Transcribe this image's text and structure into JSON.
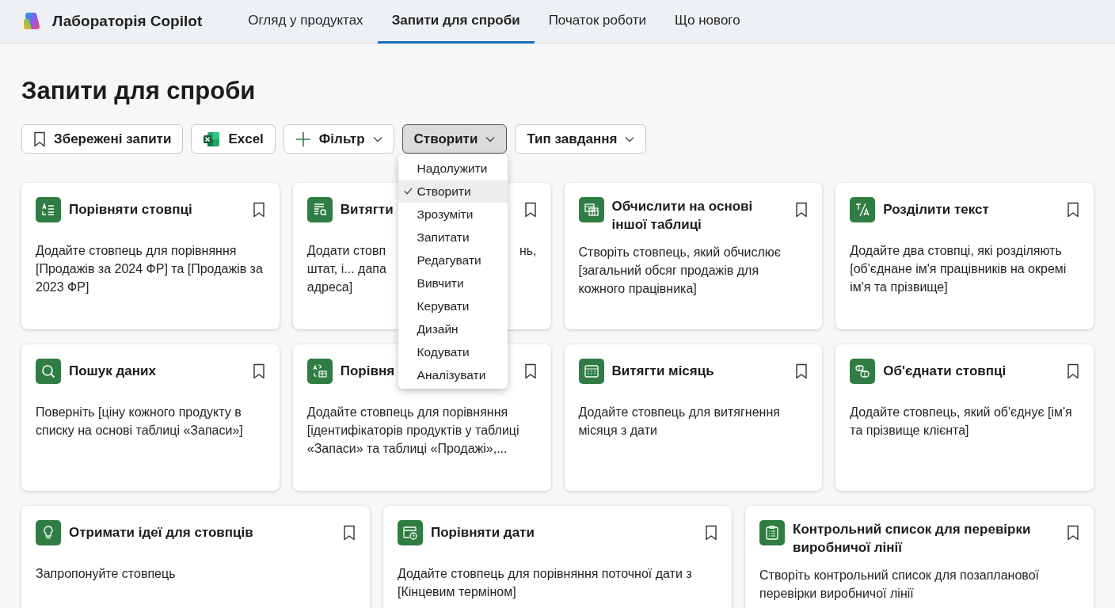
{
  "header": {
    "app_name": "Лабораторія Copilot",
    "nav": [
      {
        "label": "Огляд у продуктах",
        "selected": false
      },
      {
        "label": "Запити для спроби",
        "selected": true
      },
      {
        "label": "Початок роботи",
        "selected": false
      },
      {
        "label": "Що нового",
        "selected": false
      }
    ]
  },
  "page_title": "Запити для спроби",
  "toolbar": [
    {
      "kind": "saved",
      "label": "Збережені запити",
      "expanded": false
    },
    {
      "kind": "excel",
      "label": "Excel",
      "expanded": false
    },
    {
      "kind": "filter",
      "label": "Фільтр",
      "expanded": false
    },
    {
      "kind": "dropdown",
      "label": "Створити",
      "expanded": true
    },
    {
      "kind": "dropdown",
      "label": "Тип завдання",
      "expanded": false
    }
  ],
  "menu": {
    "items": [
      {
        "label": "Надолужити",
        "checked": false
      },
      {
        "label": "Створити",
        "checked": true
      },
      {
        "label": "Зрозуміти",
        "checked": false
      },
      {
        "label": "Запитати",
        "checked": false
      },
      {
        "label": "Редагувати",
        "checked": false
      },
      {
        "label": "Вивчити",
        "checked": false
      },
      {
        "label": "Керувати",
        "checked": false
      },
      {
        "label": "Дизайн",
        "checked": false
      },
      {
        "label": "Кодувати",
        "checked": false
      },
      {
        "label": "Аналізувати",
        "checked": false
      }
    ]
  },
  "card_rows": [
    [
      {
        "title": "Порівняти стовпці",
        "description": "Додайте стовпець для порівняння [Продажів за 2024 ФР] та [Продажів за 2023 ФР]"
      },
      {
        "title": "Витягти",
        "description_lines": [
          {
            "text": "Додати стовп",
            "end": "нь,"
          },
          {
            "text": "штат, і... дапа"
          },
          {
            "text": "адреса]"
          }
        ]
      },
      {
        "title": "Обчислити на основі іншої таблиці",
        "description": "Створіть стовпець, який обчислює [загальний обсяг продажів для кожного працівника]"
      },
      {
        "title": "Розділити текст",
        "description": "Додайте два стовпці, які розділяють [об'єднане ім'я працівників на окремі ім'я та прізвище]"
      }
    ],
    [
      {
        "title": "Пошук даних",
        "description": "Поверніть [ціну кожного продукту в списку на основі таблиці «Запаси»]"
      },
      {
        "title": "Порівня",
        "description": "Додайте стовпець для порівняння [ідентифікаторів продуктів у таблиці «Запаси» та таблиці «Продажі»,..."
      },
      {
        "title": "Витягти місяць",
        "description": "Додайте стовпець для витягнення місяця з дати"
      },
      {
        "title": "Об'єднати стовпці",
        "description": "Додайте стовпець, який об'єднує [ім'я та прізвище клієнта]"
      }
    ],
    [
      {
        "title": "Отримати ідеї для стовпців",
        "description": "Запропонуйте стовпець"
      },
      {
        "title": "Порівняти дати",
        "description": "Додайте стовпець для порівняння поточної дати з [Кінцевим терміном]"
      },
      {
        "title": "Контрольний список для перевірки виробничої лінії",
        "description": "Створіть контрольний список для позапланової перевірки виробничої лінії"
      }
    ]
  ]
}
